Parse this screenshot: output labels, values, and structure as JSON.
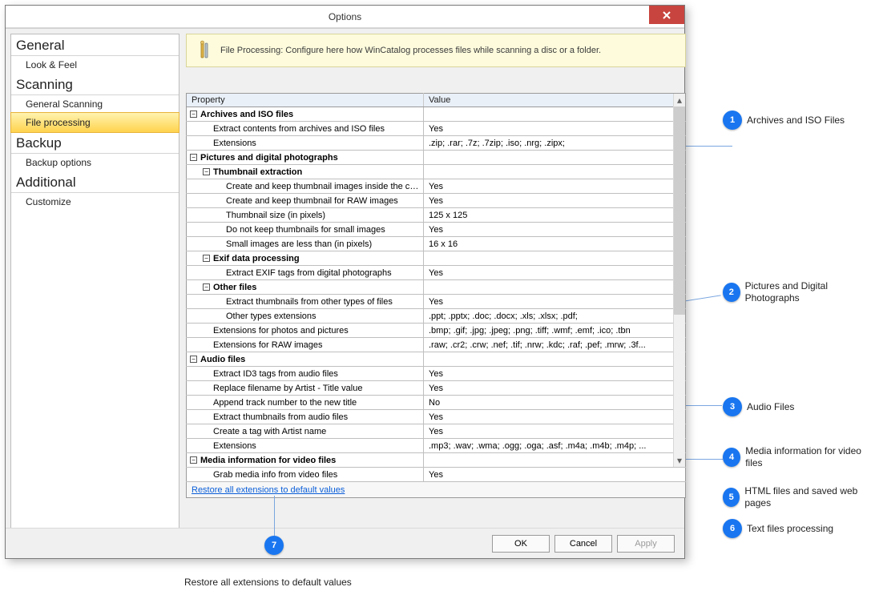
{
  "window": {
    "title": "Options"
  },
  "sidebar": {
    "sections": [
      {
        "title": "General",
        "items": [
          {
            "label": "Look & Feel",
            "selected": false
          }
        ]
      },
      {
        "title": "Scanning",
        "items": [
          {
            "label": "General Scanning",
            "selected": false
          },
          {
            "label": "File processing",
            "selected": true
          }
        ]
      },
      {
        "title": "Backup",
        "items": [
          {
            "label": "Backup options",
            "selected": false
          }
        ]
      },
      {
        "title": "Additional",
        "items": [
          {
            "label": "Customize",
            "selected": false
          }
        ]
      }
    ]
  },
  "info_message": "File Processing: Configure here how WinCatalog processes files while scanning a disc or a folder.",
  "grid": {
    "columns": {
      "property": "Property",
      "value": "Value"
    },
    "restore_link": "Restore all extensions to default values",
    "rows": [
      {
        "level": 0,
        "group": true,
        "expanded": true,
        "label": "Archives and ISO files",
        "value": ""
      },
      {
        "level": 1,
        "group": false,
        "label": "Extract contents from archives and ISO files",
        "value": "Yes"
      },
      {
        "level": 1,
        "group": false,
        "label": "Extensions",
        "value": ".zip; .rar; .7z; .7zip; .iso; .nrg; .zipx;"
      },
      {
        "level": 0,
        "group": true,
        "expanded": true,
        "label": "Pictures and digital photographs",
        "value": ""
      },
      {
        "level": 1,
        "group": true,
        "expanded": true,
        "label": "Thumbnail extraction",
        "value": ""
      },
      {
        "level": 2,
        "group": false,
        "label": "Create and keep thumbnail images inside the catal...",
        "value": "Yes"
      },
      {
        "level": 2,
        "group": false,
        "label": "Create and keep thumbnail for RAW images",
        "value": "Yes"
      },
      {
        "level": 2,
        "group": false,
        "label": "Thumbnail size (in pixels)",
        "value": "125 x 125"
      },
      {
        "level": 2,
        "group": false,
        "label": "Do not keep thumbnails for small images",
        "value": "Yes"
      },
      {
        "level": 2,
        "group": false,
        "label": "Small images are less than (in pixels)",
        "value": "16 x 16"
      },
      {
        "level": 1,
        "group": true,
        "expanded": true,
        "label": "Exif data processing",
        "value": ""
      },
      {
        "level": 2,
        "group": false,
        "label": "Extract EXIF tags from digital photographs",
        "value": "Yes"
      },
      {
        "level": 1,
        "group": true,
        "expanded": true,
        "label": "Other files",
        "value": ""
      },
      {
        "level": 2,
        "group": false,
        "label": "Extract thumbnails from other types of files",
        "value": "Yes"
      },
      {
        "level": 2,
        "group": false,
        "label": "Other types extensions",
        "value": ".ppt; .pptx; .doc; .docx; .xls; .xlsx; .pdf;"
      },
      {
        "level": 1,
        "group": false,
        "label": "Extensions for photos and pictures",
        "value": ".bmp; .gif; .jpg; .jpeg; .png; .tiff; .wmf; .emf; .ico; .tbn"
      },
      {
        "level": 1,
        "group": false,
        "label": "Extensions for RAW images",
        "value": ".raw; .cr2; .crw; .nef; .tif; .nrw; .kdc; .raf; .pef; .mrw; .3f..."
      },
      {
        "level": 0,
        "group": true,
        "expanded": true,
        "label": "Audio files",
        "value": ""
      },
      {
        "level": 1,
        "group": false,
        "label": "Extract ID3 tags from audio files",
        "value": "Yes"
      },
      {
        "level": 1,
        "group": false,
        "label": "Replace filename by Artist - Title value",
        "value": "Yes"
      },
      {
        "level": 1,
        "group": false,
        "label": "Append track number to the new title",
        "value": "No"
      },
      {
        "level": 1,
        "group": false,
        "label": "Extract thumbnails from audio files",
        "value": "Yes"
      },
      {
        "level": 1,
        "group": false,
        "label": "Create a tag with Artist name",
        "value": "Yes"
      },
      {
        "level": 1,
        "group": false,
        "label": "Extensions",
        "value": ".mp3; .wav; .wma; .ogg; .oga; .asf; .m4a; .m4b; .m4p; ..."
      },
      {
        "level": 0,
        "group": true,
        "expanded": true,
        "label": "Media information for video files",
        "value": ""
      },
      {
        "level": 1,
        "group": false,
        "label": "Grab media info from video files",
        "value": "Yes"
      }
    ]
  },
  "buttons": {
    "ok": "OK",
    "cancel": "Cancel",
    "apply": "Apply"
  },
  "callouts": {
    "c1": "Archives and ISO Files",
    "c2": "Pictures and Digital Photographs",
    "c3": "Audio Files",
    "c4": "Media information for video files",
    "c5": "HTML files and saved web pages",
    "c6": "Text files processing",
    "c7": "Restore all extensions to default values"
  }
}
